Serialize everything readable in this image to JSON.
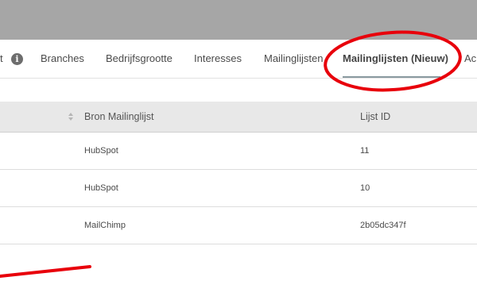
{
  "tabs": {
    "truncated_left": "t",
    "items": [
      {
        "label": "Branches"
      },
      {
        "label": "Bedrijfsgrootte"
      },
      {
        "label": "Interesses"
      },
      {
        "label": "Mailinglijsten"
      },
      {
        "label": "Mailinglijsten (Nieuw)",
        "active": true
      },
      {
        "label": "Ac"
      }
    ]
  },
  "icons": {
    "info": "info-icon",
    "sort": "sort-icon"
  },
  "table": {
    "columns": [
      "Bron Mailinglijst",
      "Lijst ID"
    ],
    "rows": [
      {
        "source": "HubSpot",
        "list_id": "11"
      },
      {
        "source": "HubSpot",
        "list_id": "10"
      },
      {
        "source": "MailChimp",
        "list_id": "2b05dc347f"
      }
    ]
  },
  "colors": {
    "annotation": "#e8000b",
    "header_bar": "#a6a6a6"
  }
}
